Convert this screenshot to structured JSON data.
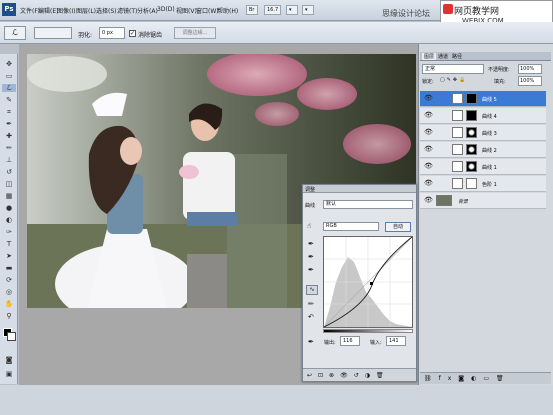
{
  "app": {
    "logo": "Ps",
    "zoom": "16.7"
  },
  "menu": {
    "items": [
      "文件(F)",
      "编辑(E)",
      "图像(I)",
      "图层(L)",
      "选择(S)",
      "滤镜(T)",
      "分析(A)",
      "3D(D)",
      "视图(V)",
      "窗口(W)",
      "帮助(H)"
    ]
  },
  "watermark": {
    "site_text": "思缘设计论坛",
    "brand_text": "网页教学网",
    "brand_url": "WEBJX.COM"
  },
  "options": {
    "feather_label": "羽化:",
    "feather_value": "0 px",
    "antialias_label": "消除锯齿",
    "refine_edge": "调整边缘..."
  },
  "layers_panel": {
    "tabs": [
      "图层",
      "通道",
      "路径"
    ],
    "blend_mode": "正常",
    "opacity_label": "不透明度:",
    "opacity_value": "100%",
    "lock_label": "锁定:",
    "fill_label": "填充:",
    "fill_value": "100%",
    "layers": [
      {
        "name": "曲线 5",
        "active": true
      },
      {
        "name": "曲线 4",
        "active": false
      },
      {
        "name": "曲线 3",
        "active": false
      },
      {
        "name": "曲线 2",
        "active": false
      },
      {
        "name": "曲线 1",
        "active": false
      },
      {
        "name": "色阶 1",
        "active": false
      },
      {
        "name": "背景",
        "active": false
      }
    ]
  },
  "curves": {
    "panel_title": "调整",
    "label": "曲线",
    "preset": "默认",
    "channel": "RGB",
    "auto": "自动",
    "output_label": "输出:",
    "output_value": "116",
    "input_label": "输入:",
    "input_value": "141"
  },
  "colors": {
    "accent": "#3a7bd5",
    "panel": "#d3d8de"
  }
}
